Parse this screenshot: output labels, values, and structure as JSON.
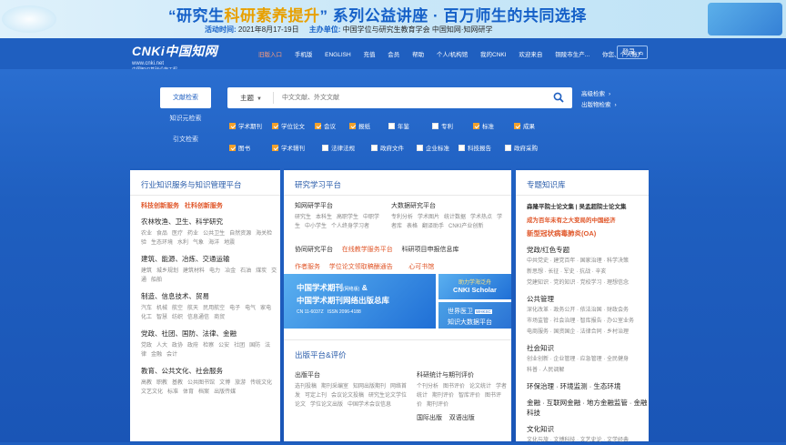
{
  "banner": {
    "title_a": "“研究生",
    "title_hl": "科研素养提升",
    "title_b": "” 系列公益讲座 · 百万师生的共同选择",
    "time_label": "活动时间:",
    "time_value": "2021年8月17-19日",
    "org_label": "主办单位:",
    "org_value": "中国学位与研究生教育学会  中国知网·知网研学"
  },
  "logo": {
    "name": "CNKi中国知网",
    "url": "www.cnki.net",
    "tagline": "中国知识基础设施工程"
  },
  "nav": {
    "items": [
      "旧版入口",
      "手机版",
      "ENGLISH",
      "充值",
      "会员",
      "帮助",
      "个人/机构馆",
      "我的CNKI",
      "欢迎来自",
      "铜陵市生产...",
      "你您、个人账户"
    ],
    "login": "登录 ⌄"
  },
  "search": {
    "tabs": [
      "文献检索",
      "知识元检索",
      "引文检索"
    ],
    "scope": "主题",
    "placeholder": "中文文献、外文文献",
    "advanced": "高级检索",
    "publication": "出版物检索"
  },
  "options": {
    "row1": [
      {
        "label": "学术期刊",
        "on": true
      },
      {
        "label": "学位论文",
        "on": true
      },
      {
        "label": "会议",
        "on": true
      },
      {
        "label": "报纸",
        "on": true
      },
      {
        "label": "年鉴",
        "on": false
      },
      {
        "label": "专利",
        "on": false
      },
      {
        "label": "标准",
        "on": true
      },
      {
        "label": "成果",
        "on": true
      }
    ],
    "row2": [
      {
        "label": "图书",
        "on": true
      },
      {
        "label": "学术辑刊",
        "on": true
      },
      {
        "label": "法律法规",
        "on": false
      },
      {
        "label": "政府文件",
        "on": false
      },
      {
        "label": "企业标准",
        "on": false
      },
      {
        "label": "科技报告",
        "on": false
      },
      {
        "label": "政府采购",
        "on": false
      }
    ]
  },
  "panel1": {
    "title": "行业知识服务与知识管理平台",
    "links": [
      "科技创新服务",
      "社科创新服务"
    ],
    "sections": [
      {
        "name": "农林牧渔、卫生、科学研究",
        "items": [
          "农业",
          "食品",
          "医疗",
          "药业",
          "公共卫生",
          "自然资源",
          "海关检验",
          "生态环境",
          "水利",
          "气象",
          "海洋",
          "地震"
        ]
      },
      {
        "name": "建筑、能源、冶炼、交通运输",
        "items": [
          "建筑",
          "城乡规划",
          "建筑材料",
          "电力",
          "冶金",
          "石油",
          "煤炭",
          "交通",
          "船舶"
        ]
      },
      {
        "name": "制造、信息技术、贸易",
        "items": [
          "汽车",
          "机械",
          "航空",
          "航天",
          "民用航空",
          "电子",
          "电气",
          "家电",
          "化工",
          "智慧",
          "纺织",
          "信息通信",
          "商贸"
        ]
      },
      {
        "name": "党政、社团、国防、法律、金融",
        "items": [
          "党政",
          "人大",
          "政协",
          "政府",
          "检察",
          "公安",
          "社团",
          "国防",
          "法律",
          "金融",
          "会计"
        ]
      },
      {
        "name": "教育、公共文化、社会服务",
        "items": [
          "高教",
          "职教",
          "基教",
          "公共图书馆",
          "文博",
          "旅游",
          "传统文化",
          "文艺文化",
          "标准",
          "体育",
          "档案",
          "出版传媒"
        ]
      }
    ]
  },
  "panel2": {
    "title": "研究学习平台",
    "col1": {
      "head": "知网研学平台",
      "items": [
        "研究生",
        "本科生",
        "高职学生",
        "中职学生",
        "中小学生",
        "个人终身学习者"
      ]
    },
    "col2": {
      "head": "大数据研究平台",
      "items": [
        "专利分析",
        "学术图片",
        "统计数据",
        "学术热点",
        "学者库",
        "表格",
        "翻译助手",
        "CNKI产业创新"
      ]
    },
    "row3": [
      "协同研究平台",
      "在线教学服务平台",
      "科研项目申报信息库"
    ],
    "row4": [
      "作者服务",
      "学位论文领取稿酬通告",
      "心可书馆"
    ],
    "promo1": {
      "l1": "中国学术期刊",
      "l1s": "(网络版)",
      "l1b": "&",
      "l2": "中国学术期刊网络出版总库",
      "cn": "CN 11-6037Z",
      "issn": "ISSN 2096-4188"
    },
    "promo2": {
      "top": "助力学海泛舟",
      "name": "CNKI Scholar"
    },
    "promo3": {
      "l1": "世界医卫",
      "badge": "WHKSC",
      "l2": "知识大数据平台"
    },
    "pub": {
      "title": "出版平台&评价",
      "c1head": "出版平台",
      "c1": [
        "选刊投稿",
        "期刊采编室",
        "知网出版期刊",
        "网络首发",
        "可定上刊",
        "会议论文投稿",
        "研究生论文学位论文",
        "学位论文出版",
        "中国学术会议信息"
      ],
      "c2head": "科研统计与期刊评价",
      "c2": [
        "个刊分析",
        "图书评价",
        "论文统计",
        "学者统计",
        "期刊评价",
        "智库评价",
        "图书评价",
        "期刊评价"
      ],
      "c3": [
        "国际出版",
        "双语出版"
      ]
    }
  },
  "panel3": {
    "title": "专题知识库",
    "items": [
      {
        "t": "森隆平院士论文集",
        "extra": "吴孟超院士论文集",
        "cls": "bold"
      },
      {
        "t": "成为百年未有之大变局的中国经济",
        "cls": "red"
      },
      {
        "t": "新型冠状病毒肺炎(OA)",
        "cls": "red big"
      },
      {
        "t": "党政/红色专题",
        "cls": "sec"
      },
      {
        "t": "中共党史 · 建党百年 · 国家治理 · 科学决策",
        "cls": "sub"
      },
      {
        "t": "新思想 · 长征 · 军史 · 抗战 · 辛亥",
        "cls": "sub"
      },
      {
        "t": "党建知识 · 党的知识 · 党校学习 · 理想信念",
        "cls": "sub"
      },
      {
        "t": "公共管理",
        "cls": "sec"
      },
      {
        "t": "深化改革 · 政务公开 · 依法治国 · 财政会务",
        "cls": "sub"
      },
      {
        "t": "市场监管 · 社会治理 · 智库报告 · 办公室业务",
        "cls": "sub"
      },
      {
        "t": "电商服务 · 国资国企 · 法律合同 · 乡村治理",
        "cls": "sub"
      },
      {
        "t": "社会知识",
        "cls": "sec"
      },
      {
        "t": "创业创新 · 企业管理 · 应急管理 · 全民健身",
        "cls": "sub"
      },
      {
        "t": "科普 · 人民调解",
        "cls": "sub"
      },
      {
        "t": "环保治理 · 环境监测 · 生态环境",
        "cls": "secinline"
      },
      {
        "t": "金融 · 互联网金融 · 地方金融监管 · 金融科技",
        "cls": "secinline"
      },
      {
        "t": "文化知识",
        "cls": "sec"
      },
      {
        "t": "文化与旅 · 文博科技 · 文艺史论 · 文学经典",
        "cls": "sub"
      }
    ]
  }
}
